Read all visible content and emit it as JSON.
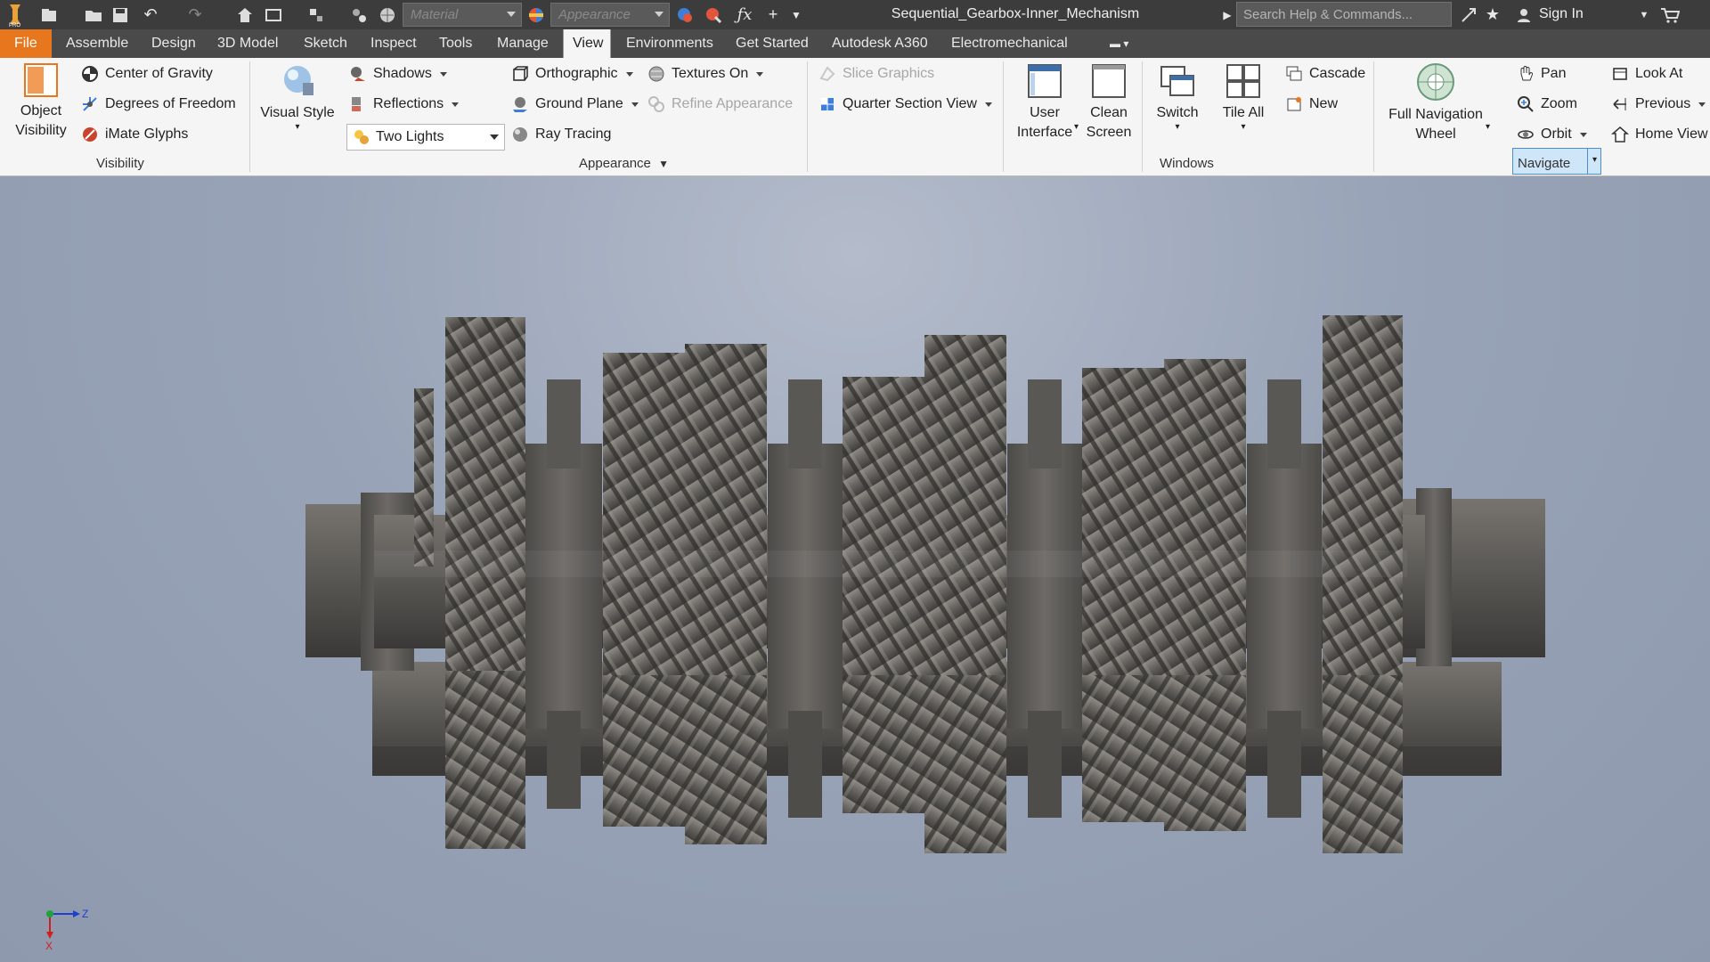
{
  "app": {
    "document_title": "Sequential_Gearbox-Inner_Mechanism",
    "material_placeholder": "Material",
    "appearance_placeholder": "Appearance",
    "search_placeholder": "Search Help & Commands...",
    "sign_in": "Sign In",
    "accent_color": "#e8761d"
  },
  "tabs": [
    {
      "label": "File"
    },
    {
      "label": "Assemble"
    },
    {
      "label": "Design"
    },
    {
      "label": "3D Model"
    },
    {
      "label": "Sketch"
    },
    {
      "label": "Inspect"
    },
    {
      "label": "Tools"
    },
    {
      "label": "Manage"
    },
    {
      "label": "View",
      "active": true
    },
    {
      "label": "Environments"
    },
    {
      "label": "Get Started"
    },
    {
      "label": "Autodesk A360"
    },
    {
      "label": "Electromechanical"
    }
  ],
  "ribbon": {
    "visibility": {
      "title": "Visibility",
      "object_visibility_1": "Object",
      "object_visibility_2": "Visibility",
      "center_of_gravity": "Center of Gravity",
      "degrees_of_freedom": "Degrees of Freedom",
      "imate_glyphs": "iMate Glyphs"
    },
    "appearance": {
      "title": "Appearance",
      "visual_style": "Visual Style",
      "shadows": "Shadows",
      "reflections": "Reflections",
      "lights_value": "Two Lights",
      "orthographic": "Orthographic",
      "ground_plane": "Ground Plane",
      "ray_tracing": "Ray Tracing",
      "textures_on": "Textures On",
      "refine_appearance": "Refine Appearance",
      "slice_graphics": "Slice Graphics",
      "quarter_section_view": "Quarter Section View"
    },
    "windows": {
      "title": "Windows",
      "user_interface_1": "User",
      "user_interface_2": "Interface",
      "clean_screen_1": "Clean",
      "clean_screen_2": "Screen",
      "switch": "Switch",
      "tile_all": "Tile All",
      "cascade": "Cascade",
      "new": "New"
    },
    "navigate": {
      "title": "Navigate",
      "full_nav_1": "Full Navigation",
      "full_nav_2": "Wheel",
      "pan": "Pan",
      "zoom": "Zoom",
      "orbit": "Orbit",
      "look_at": "Look At",
      "previous": "Previous",
      "home_view": "Home View"
    }
  },
  "viewport": {
    "triad_z": "Z",
    "triad_x": "X"
  }
}
